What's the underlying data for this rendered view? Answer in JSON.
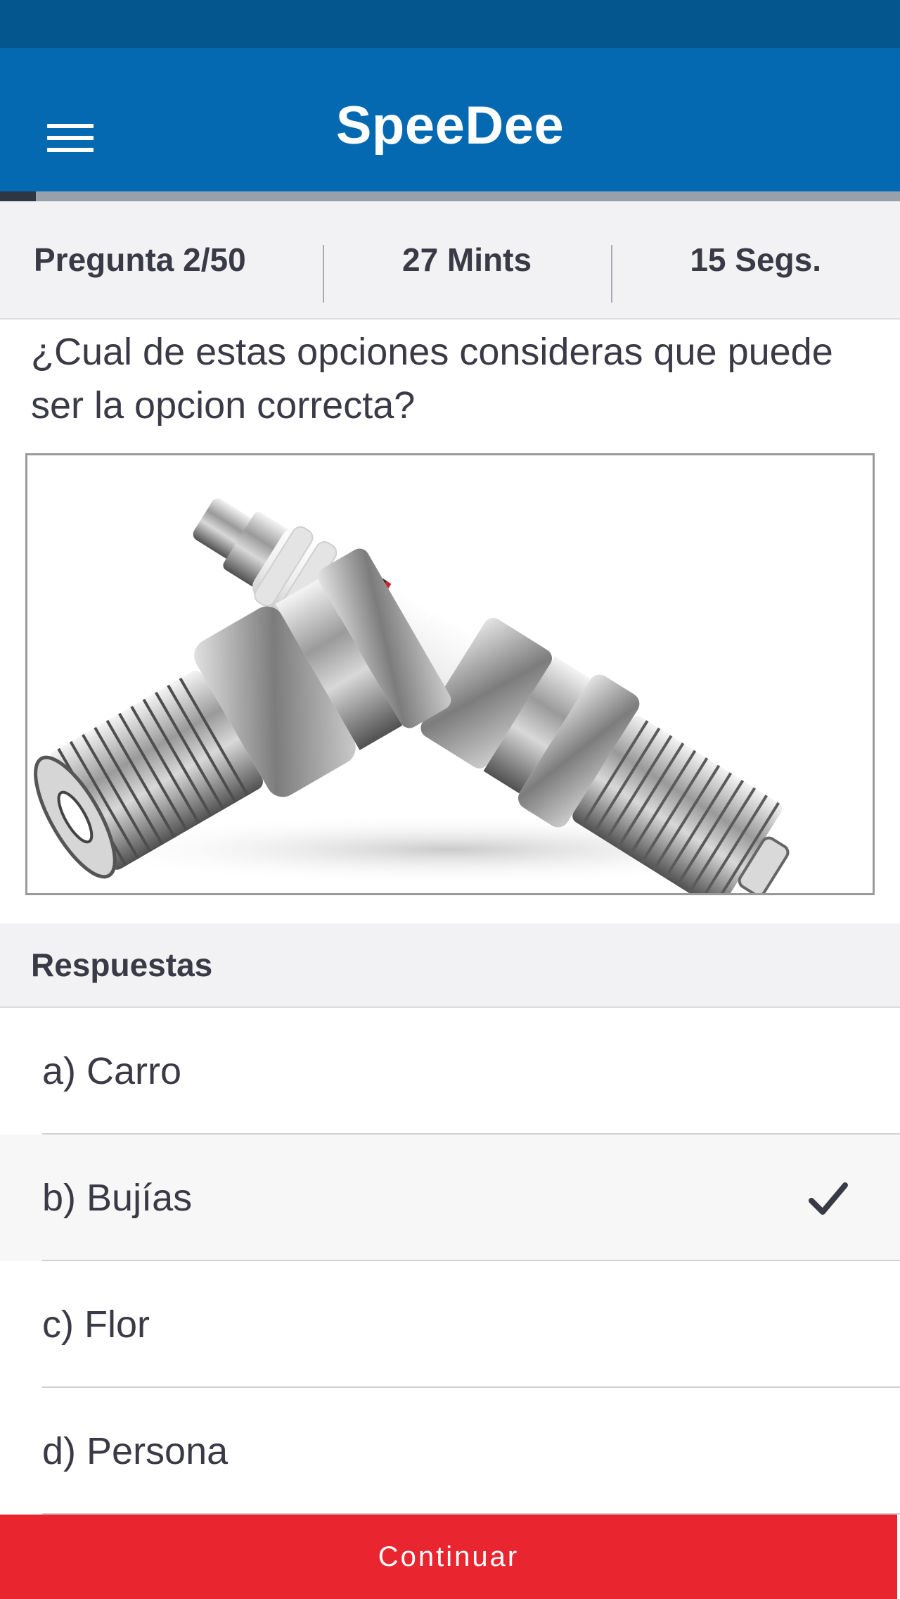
{
  "app": {
    "title": "SpeeDee"
  },
  "header": {
    "menu_icon": "hamburger-menu-icon"
  },
  "progress": {
    "fraction": 0.04
  },
  "stats": {
    "question": "Pregunta 2/50",
    "minutes": "27 Mints",
    "seconds": "15 Segs."
  },
  "question": {
    "text": "¿Cual de estas opciones consideras que puede ser la opcion correcta?",
    "image": "spark-plugs-photo"
  },
  "answers": {
    "header": "Respuestas",
    "items": [
      {
        "label": "a) Carro",
        "selected": false
      },
      {
        "label": "b) Bujías",
        "selected": true
      },
      {
        "label": "c) Flor",
        "selected": false
      },
      {
        "label": "d) Persona",
        "selected": false
      }
    ]
  },
  "footer": {
    "continue_label": "Continuar"
  },
  "colors": {
    "status_bar": "#03568e",
    "app_bar": "#0569b2",
    "progress_fill": "#2e3543",
    "progress_track": "#98a0ab",
    "continue_button": "#e92530"
  }
}
